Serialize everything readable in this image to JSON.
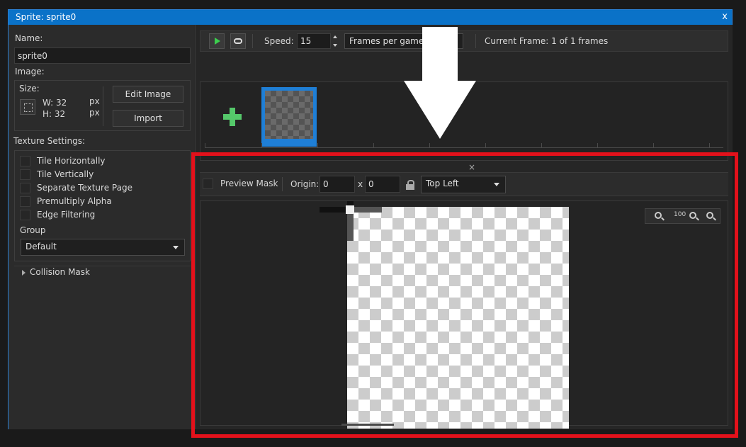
{
  "window": {
    "title": "Sprite: sprite0",
    "close_glyph": "x"
  },
  "left": {
    "name_label": "Name:",
    "name_value": "sprite0",
    "image_label": "Image:",
    "size_label": "Size:",
    "width_label": "W: 32",
    "height_label": "H: 32",
    "unit_w": "px",
    "unit_h": "px",
    "edit_image_label": "Edit Image",
    "import_label": "Import",
    "texture_settings_label": "Texture Settings:",
    "checkboxes": [
      "Tile Horizontally",
      "Tile Vertically",
      "Separate Texture Page",
      "Premultiply Alpha",
      "Edge Filtering"
    ],
    "group_label": "Group",
    "group_value": "Default",
    "collision_mask_label": "Collision Mask"
  },
  "toolbar": {
    "speed_label": "Speed:",
    "speed_value": "15",
    "speed_unit": "Frames per game",
    "current_frame": "Current Frame: 1 of 1 frames"
  },
  "editor": {
    "dock_close_glyph": "×",
    "preview_mask_label": "Preview Mask",
    "origin_label": "Origin:",
    "origin_x": "0",
    "origin_sep": "x",
    "origin_y": "0",
    "origin_preset": "Top Left",
    "zoom_icons": [
      "zoom-out-icon",
      "zoom-100-icon",
      "zoom-in-icon",
      "zoom-fit-icon"
    ],
    "zoom_100_label": "100"
  },
  "colors": {
    "title_bar": "#0a72c8",
    "highlight": "#e3111b",
    "add_frame": "#55c86a",
    "play": "#3ccf4e"
  }
}
